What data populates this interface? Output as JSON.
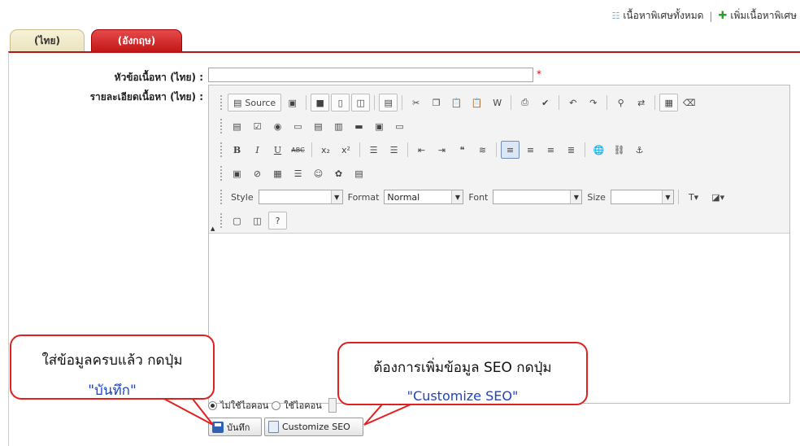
{
  "toplinks": {
    "all_content": "เนื้อหาพิเศษทั้งหมด",
    "separator": "|",
    "add_content": "เพิ่มเนื้อหาพิเศษ"
  },
  "tabs": {
    "thai": "(ไทย)",
    "english": "(อังกฤษ)"
  },
  "form": {
    "title_label": "หัวข้อเนื้อหา (ไทย) :",
    "title_value": "",
    "required_mark": "*",
    "detail_label": "รายละเอียดเนื้อหา (ไทย) :"
  },
  "editor": {
    "source_label": "Source",
    "style_label": "Style",
    "style_value": "",
    "format_label": "Format",
    "format_value": "Normal",
    "font_label": "Font",
    "font_value": "",
    "size_label": "Size",
    "size_value": ""
  },
  "icon_option": {
    "no_icon": "ไม่ใช้ไอคอน",
    "use_icon": "ใช้ไอคอน",
    "selected": "no_icon"
  },
  "buttons": {
    "save": "บันทึก",
    "customize_seo": "Customize SEO"
  },
  "callouts": {
    "save": {
      "text": "ใส่ข้อมูลครบแล้ว กดปุ่ม",
      "highlight": "\"บันทึก\""
    },
    "seo": {
      "text": "ต้องการเพิ่มข้อมูล SEO กดปุ่ม",
      "highlight": "\"Customize SEO\""
    }
  },
  "colors": {
    "tab_active_bg": "#ebe3bf",
    "tab_inactive_bg": "#c31616",
    "accent_red": "#e12020",
    "highlight_blue": "#1b44c7"
  },
  "icons": [
    "list-icon",
    "plus-icon",
    "disk-icon",
    "page-icon"
  ]
}
